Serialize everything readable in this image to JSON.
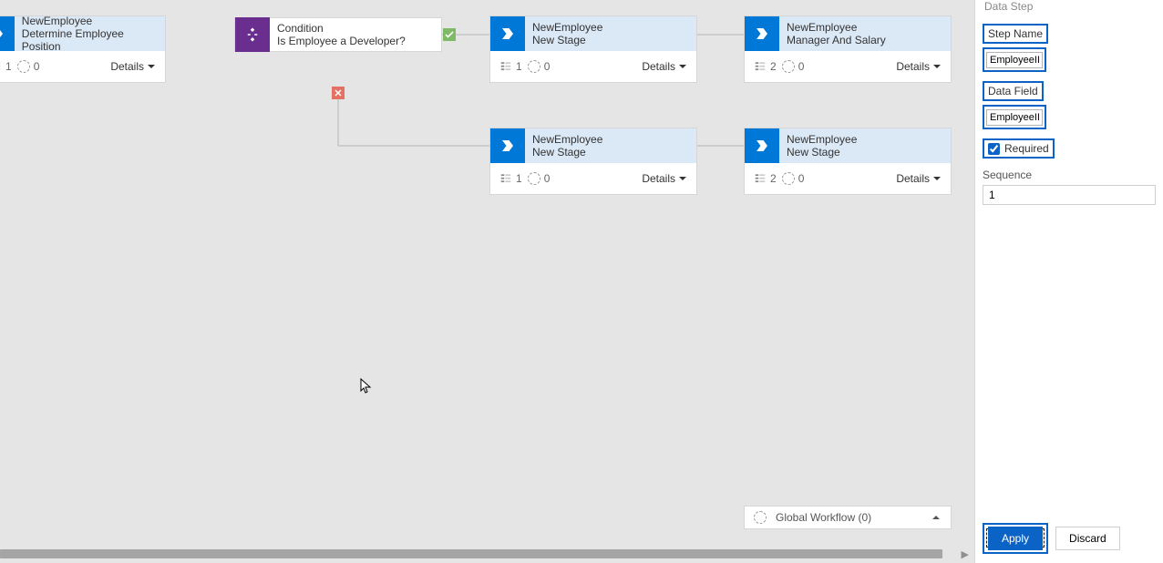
{
  "rightPanel": {
    "header": "Data Step",
    "stepNameLabel": "Step Name",
    "stepNameValue": "EmployeeID",
    "dataFieldLabel": "Data Field",
    "dataFieldValue": "EmployeeID",
    "requiredLabel": "Required",
    "sequenceLabel": "Sequence",
    "sequenceValue": "1",
    "applyLabel": "Apply",
    "discardLabel": "Discard"
  },
  "globalWorkflow": {
    "label": "Global Workflow (0)"
  },
  "nodes": {
    "n1": {
      "title": "NewEmployee",
      "sub": "Determine Employee Position",
      "steps": "1",
      "count": "0",
      "details": "Details"
    },
    "cond": {
      "title": "Condition",
      "sub": "Is Employee a Developer?"
    },
    "n3": {
      "title": "NewEmployee",
      "sub": "New Stage",
      "steps": "1",
      "count": "0",
      "details": "Details"
    },
    "n4": {
      "title": "NewEmployee",
      "sub": "Manager And Salary",
      "steps": "2",
      "count": "0",
      "details": "Details"
    },
    "n5": {
      "title": "NewEmployee",
      "sub": "New Stage",
      "steps": "1",
      "count": "0",
      "details": "Details"
    },
    "n6": {
      "title": "NewEmployee",
      "sub": "New Stage",
      "steps": "2",
      "count": "0",
      "details": "Details"
    }
  }
}
